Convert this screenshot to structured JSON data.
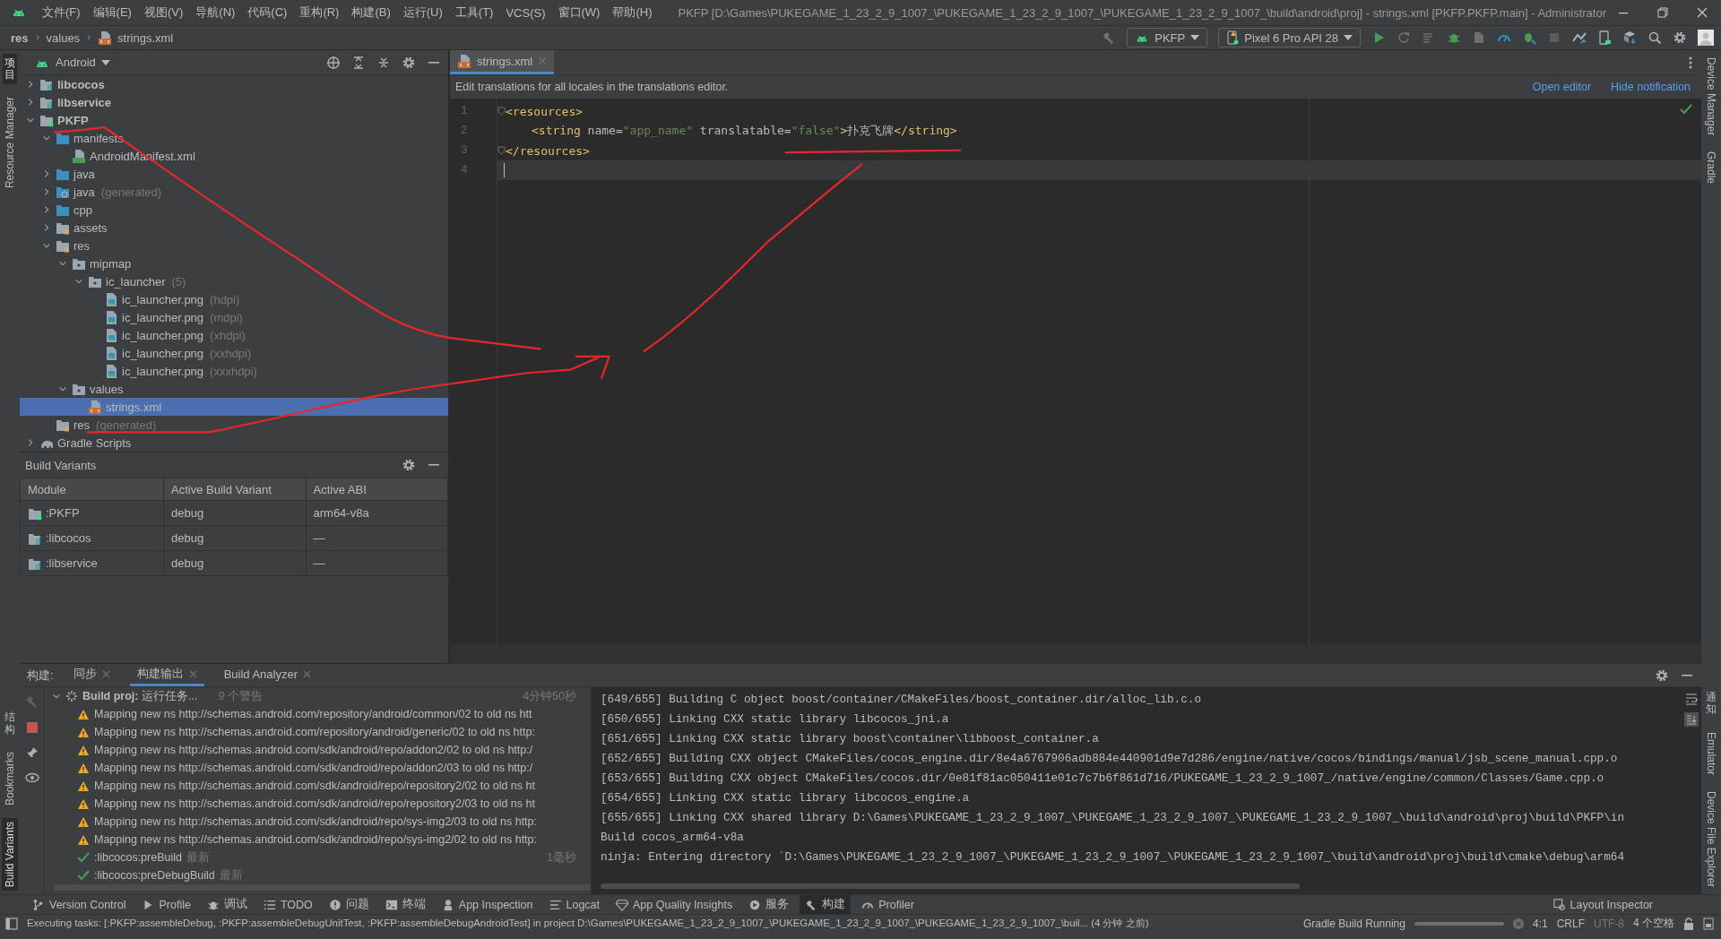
{
  "title_bar": {
    "menus": [
      "文件(F)",
      "编辑(E)",
      "视图(V)",
      "导航(N)",
      "代码(C)",
      "重构(R)",
      "构建(B)",
      "运行(U)",
      "工具(T)",
      "VCS(S)",
      "窗口(W)",
      "帮助(H)"
    ],
    "title": "PKFP [D:\\Games\\PUKEGAME_1_23_2_9_1007_\\PUKEGAME_1_23_2_9_1007_\\PUKEGAME_1_23_2_9_1007_\\build\\android\\proj] - strings.xml [PKFP.PKFP.main] - Administrator"
  },
  "nav_bar": {
    "breadcrumbs": [
      "res",
      "values",
      "strings.xml"
    ],
    "run_config": "PKFP",
    "device": "Pixel 6 Pro API 28"
  },
  "left_strip": {
    "top": [
      {
        "label": "项目",
        "selected": true
      },
      {
        "label": "Resource Manager",
        "selected": false
      }
    ],
    "bottom": [
      {
        "label": "结构",
        "selected": false
      },
      {
        "label": "Bookmarks",
        "selected": false
      },
      {
        "label": "Build Variants",
        "selected": true
      }
    ]
  },
  "right_strip": {
    "top": [
      "Device Manager",
      "Gradle"
    ],
    "bottom": [
      "通知",
      "Emulator",
      "Device File Explorer"
    ]
  },
  "project": {
    "view": "Android",
    "tree": [
      {
        "label": "libcocos",
        "kind": "module",
        "expanded": false,
        "selected": false
      },
      {
        "label": "libservice",
        "kind": "module",
        "expanded": false,
        "selected": false
      },
      {
        "label": "PKFP",
        "kind": "app",
        "expanded": true,
        "selected": false,
        "children": [
          {
            "label": "manifests",
            "kind": "folder",
            "expanded": true,
            "selected": false,
            "children": [
              {
                "label": "AndroidManifest.xml",
                "kind": "manifest",
                "selected": false
              }
            ]
          },
          {
            "label": "java",
            "kind": "folder",
            "expanded": false,
            "selected": false
          },
          {
            "label": "java",
            "note": "(generated)",
            "kind": "folder-gen",
            "expanded": false,
            "selected": false
          },
          {
            "label": "cpp",
            "kind": "folder",
            "expanded": false,
            "selected": false
          },
          {
            "label": "assets",
            "kind": "folder-res",
            "expanded": false,
            "selected": false
          },
          {
            "label": "res",
            "kind": "folder-res",
            "expanded": true,
            "selected": false,
            "children": [
              {
                "label": "mipmap",
                "kind": "folder-pkg",
                "expanded": true,
                "selected": false,
                "children": [
                  {
                    "label": "ic_launcher",
                    "note": "(5)",
                    "kind": "folder-pkg",
                    "expanded": true,
                    "selected": false,
                    "children": [
                      {
                        "label": "ic_launcher.png",
                        "note": "(hdpi)",
                        "kind": "image",
                        "selected": false
                      },
                      {
                        "label": "ic_launcher.png",
                        "note": "(mdpi)",
                        "kind": "image",
                        "selected": false
                      },
                      {
                        "label": "ic_launcher.png",
                        "note": "(xhdpi)",
                        "kind": "image",
                        "selected": false
                      },
                      {
                        "label": "ic_launcher.png",
                        "note": "(xxhdpi)",
                        "kind": "image",
                        "selected": false
                      },
                      {
                        "label": "ic_launcher.png",
                        "note": "(xxxhdpi)",
                        "kind": "image",
                        "selected": false
                      }
                    ]
                  }
                ]
              },
              {
                "label": "values",
                "kind": "folder-pkg",
                "expanded": true,
                "selected": false,
                "children": [
                  {
                    "label": "strings.xml",
                    "kind": "xml",
                    "selected": true
                  }
                ]
              }
            ]
          },
          {
            "label": "res",
            "note": "(generated)",
            "kind": "folder-res",
            "selected": false
          }
        ]
      },
      {
        "label": "Gradle Scripts",
        "kind": "gradle",
        "expanded": false,
        "selected": false
      }
    ]
  },
  "build_variants": {
    "title": "Build Variants",
    "columns": [
      "Module",
      "Active Build Variant",
      "Active ABI"
    ],
    "rows": [
      {
        "module": ":PKFP",
        "kind": "app",
        "variant": "debug",
        "abi": "arm64-v8a"
      },
      {
        "module": ":libcocos",
        "kind": "module",
        "variant": "debug",
        "abi": "—"
      },
      {
        "module": ":libservice",
        "kind": "module",
        "variant": "debug",
        "abi": "—"
      }
    ]
  },
  "editor": {
    "tabs": [
      {
        "label": "strings.xml",
        "selected": true
      }
    ],
    "notification": {
      "text": "Edit translations for all locales in the translations editor.",
      "actions": [
        "Open editor",
        "Hide notification"
      ]
    },
    "lines": [
      {
        "number": "1",
        "current": false,
        "fold": true,
        "indented": false,
        "tokens": [
          {
            "kind": "tag",
            "text": "<resources>"
          }
        ]
      },
      {
        "number": "2",
        "current": false,
        "fold": false,
        "indented": true,
        "tokens": [
          {
            "kind": "tag",
            "text": "<string"
          },
          {
            "kind": "attr",
            "text": " name="
          },
          {
            "kind": "value",
            "text": "\"app_name\""
          },
          {
            "kind": "attr",
            "text": " translatable="
          },
          {
            "kind": "value",
            "text": "\"false\""
          },
          {
            "kind": "tag",
            "text": ">"
          },
          {
            "kind": "text",
            "text": "扑克飞牌"
          },
          {
            "kind": "tag",
            "text": "</string>"
          }
        ]
      },
      {
        "number": "3",
        "current": false,
        "fold": true,
        "indented": false,
        "tokens": [
          {
            "kind": "tag",
            "text": "</resources>"
          }
        ]
      },
      {
        "number": "4",
        "current": true,
        "fold": false,
        "indented": false
      }
    ]
  },
  "build": {
    "label": "构建:",
    "tabs": [
      {
        "label": "同步",
        "selected": false
      },
      {
        "label": "构建输出",
        "selected": true
      },
      {
        "label": "Build Analyzer",
        "selected": false
      }
    ],
    "tree": {
      "title": "Build proj:",
      "status": "运行任务...",
      "warnings": "9 个警告",
      "time": "4分钟50秒",
      "expanded": true,
      "children": [
        {
          "kind": "warning",
          "text": "Mapping new ns http://schemas.android.com/repository/android/common/02 to old ns htt"
        },
        {
          "kind": "warning",
          "text": "Mapping new ns http://schemas.android.com/repository/android/generic/02 to old ns http:"
        },
        {
          "kind": "warning",
          "text": "Mapping new ns http://schemas.android.com/sdk/android/repo/addon2/02 to old ns http:/"
        },
        {
          "kind": "warning",
          "text": "Mapping new ns http://schemas.android.com/sdk/android/repo/addon2/03 to old ns http:/"
        },
        {
          "kind": "warning",
          "text": "Mapping new ns http://schemas.android.com/sdk/android/repo/repository2/02 to old ns ht"
        },
        {
          "kind": "warning",
          "text": "Mapping new ns http://schemas.android.com/sdk/android/repo/repository2/03 to old ns ht"
        },
        {
          "kind": "warning",
          "text": "Mapping new ns http://schemas.android.com/sdk/android/repo/sys-img2/03 to old ns http:"
        },
        {
          "kind": "warning",
          "text": "Mapping new ns http://schemas.android.com/sdk/android/repo/sys-img2/02 to old ns http:"
        },
        {
          "kind": "done",
          "text": ":libcocos:preBuild",
          "note": "最新",
          "time": "1毫秒"
        },
        {
          "kind": "done",
          "text": ":libcocos:preDebugBuild",
          "note": "最新"
        }
      ]
    },
    "output": [
      "[649/655] Building C object boost/container/CMakeFiles/boost_container.dir/alloc_lib.c.o",
      "[650/655] Linking CXX static library libcocos_jni.a",
      "[651/655] Linking CXX static library boost\\container\\libboost_container.a",
      "[652/655] Building CXX object CMakeFiles/cocos_engine.dir/8e4a6767906adb884e440901d9e7d286/engine/native/cocos/bindings/manual/jsb_scene_manual.cpp.o",
      "[653/655] Building CXX object CMakeFiles/cocos.dir/0e81f81ac050411e01c7c7b6f861d716/PUKEGAME_1_23_2_9_1007_/native/engine/common/Classes/Game.cpp.o",
      "[654/655] Linking CXX static library libcocos_engine.a",
      "[655/655] Linking CXX shared library D:\\Games\\PUKEGAME_1_23_2_9_1007_\\PUKEGAME_1_23_2_9_1007_\\PUKEGAME_1_23_2_9_1007_\\build\\android\\proj\\build\\PKFP\\in",
      "Build cocos_arm64-v8a",
      "ninja: Entering directory `D:\\Games\\PUKEGAME_1_23_2_9_1007_\\PUKEGAME_1_23_2_9_1007_\\PUKEGAME_1_23_2_9_1007_\\build\\android\\proj\\build\\cmake\\debug\\arm64"
    ]
  },
  "tool_windows": {
    "items": [
      {
        "label": "Version Control",
        "kind": "branch",
        "selected": false
      },
      {
        "label": "Profile",
        "kind": "play",
        "selected": false
      },
      {
        "label": "调试",
        "kind": "bug",
        "selected": false
      },
      {
        "label": "TODO",
        "kind": "list",
        "selected": false
      },
      {
        "label": "问题",
        "kind": "alert",
        "selected": false
      },
      {
        "label": "终端",
        "kind": "terminal",
        "selected": false
      },
      {
        "label": "App Inspection",
        "kind": "inspect",
        "selected": false
      },
      {
        "label": "Logcat",
        "kind": "logcat",
        "selected": false
      },
      {
        "label": "App Quality Insights",
        "kind": "gem",
        "selected": false
      },
      {
        "label": "服务",
        "kind": "services",
        "selected": false
      },
      {
        "label": "构建",
        "kind": "hammer",
        "selected": true
      },
      {
        "label": "Profiler",
        "kind": "gauge",
        "selected": false
      }
    ],
    "right": "Layout Inspector"
  },
  "status_bar": {
    "message": "Executing tasks: [:PKFP:assembleDebug, :PKFP:assembleDebugUnitTest, :PKFP:assembleDebugAndroidTest] in project D:\\Games\\PUKEGAME_1_23_2_9_1007_\\PUKEGAME_1_23_2_9_1007_\\PUKEGAME_1_23_2_9_1007_\\buil... (4 分钟 之前)",
    "task": "Gradle Build Running",
    "position": "4:1",
    "line_separator": "CRLF",
    "encoding": "UTF-8",
    "indent": "4 个空格"
  }
}
